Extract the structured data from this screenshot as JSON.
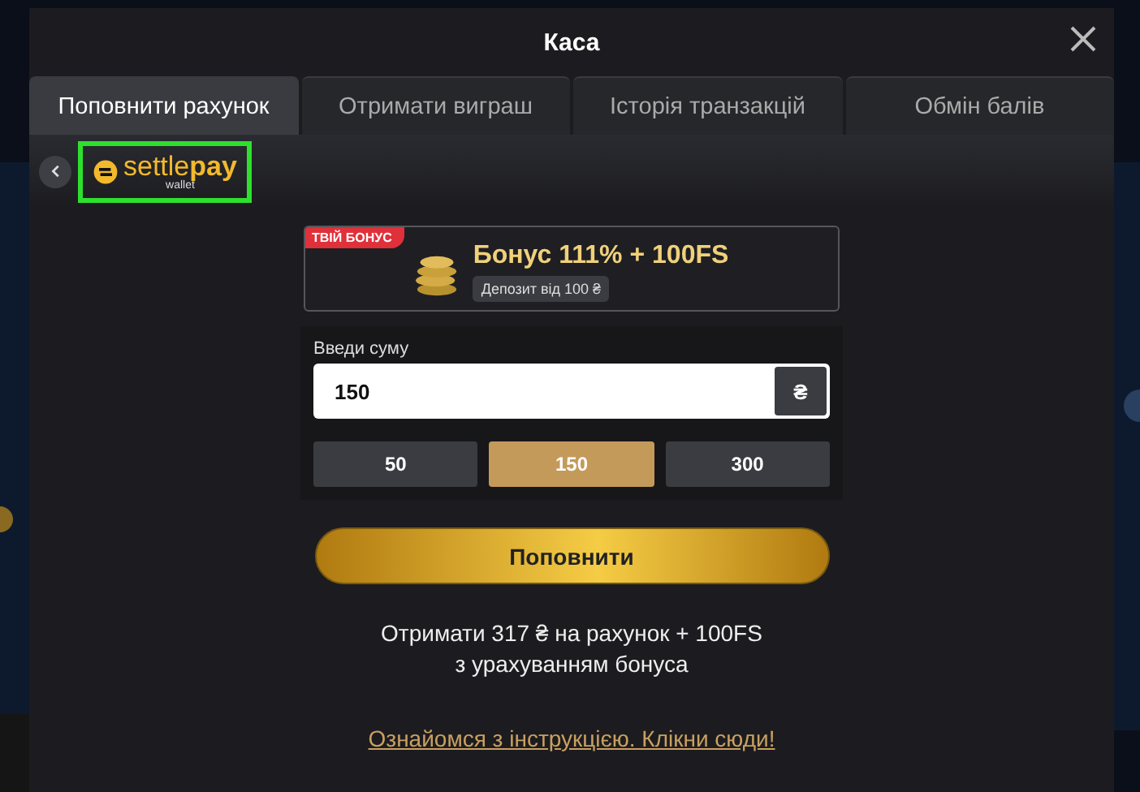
{
  "window": {
    "title": "Каса"
  },
  "tabs": [
    {
      "label": "Поповнити рахунок",
      "selected": true
    },
    {
      "label": "Отримати виграш",
      "selected": false
    },
    {
      "label": "Історія транзакцій",
      "selected": false
    },
    {
      "label": "Обмін балів",
      "selected": false
    }
  ],
  "provider": {
    "name_part_1": "settle",
    "name_part_2": "pay",
    "subtitle": "wallet",
    "highlighted": true
  },
  "bonus": {
    "badge": "ТВІЙ БОНУС",
    "title": "Бонус 111% + 100FS",
    "note": "Депозит від 100 ₴"
  },
  "amount": {
    "label": "Введи суму",
    "value": "150",
    "currency": "₴"
  },
  "presets": [
    {
      "label": "50",
      "selected": false
    },
    {
      "label": "150",
      "selected": true
    },
    {
      "label": "300",
      "selected": false
    }
  ],
  "submit": "Поповнити",
  "summary": [
    "Отримати 317 ₴ на рахунок + 100FS",
    "з урахуванням бонуса"
  ],
  "link": "Ознайомся з інструкцією. Клікни сюди!"
}
